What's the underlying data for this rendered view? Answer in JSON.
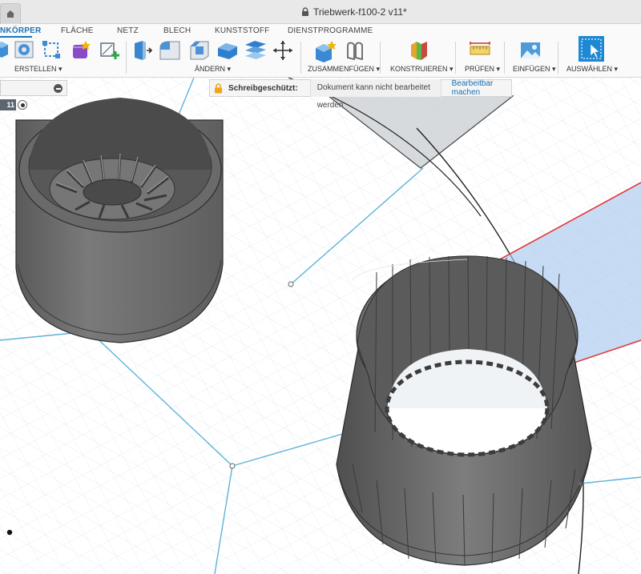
{
  "window": {
    "doc_title": "Triebwerk-f100-2 v11*"
  },
  "toolbar": {
    "tabs": [
      {
        "label": "NKÖRPER",
        "active": true
      },
      {
        "label": "FLÄCHE",
        "active": false
      },
      {
        "label": "NETZ",
        "active": false
      },
      {
        "label": "BLECH",
        "active": false
      },
      {
        "label": "KUNSTSTOFF",
        "active": false
      },
      {
        "label": "DIENSTPROGRAMME",
        "active": false
      }
    ],
    "groups": [
      {
        "label": "ERSTELLEN ▾"
      },
      {
        "label": "ÄNDERN ▾"
      },
      {
        "label": "ZUSAMMENFÜGEN ▾"
      },
      {
        "label": "KONSTRUIEREN ▾"
      },
      {
        "label": "PRÜFEN ▾"
      },
      {
        "label": "EINFÜGEN ▾"
      },
      {
        "label": "AUSWÄHLEN ▾"
      }
    ]
  },
  "timeline": {
    "badge": "11"
  },
  "banner": {
    "label": "Schreibgeschützt:",
    "message": "Dokument kann nicht bearbeitet werden",
    "action": "Bearbeitbar machen"
  },
  "colors": {
    "accent": "#1a73b8",
    "selection_edge": "#e03a3a",
    "plane_fill": "#a9c8ee",
    "axis": "#5fb3d9",
    "body": "#6f6f6f"
  }
}
